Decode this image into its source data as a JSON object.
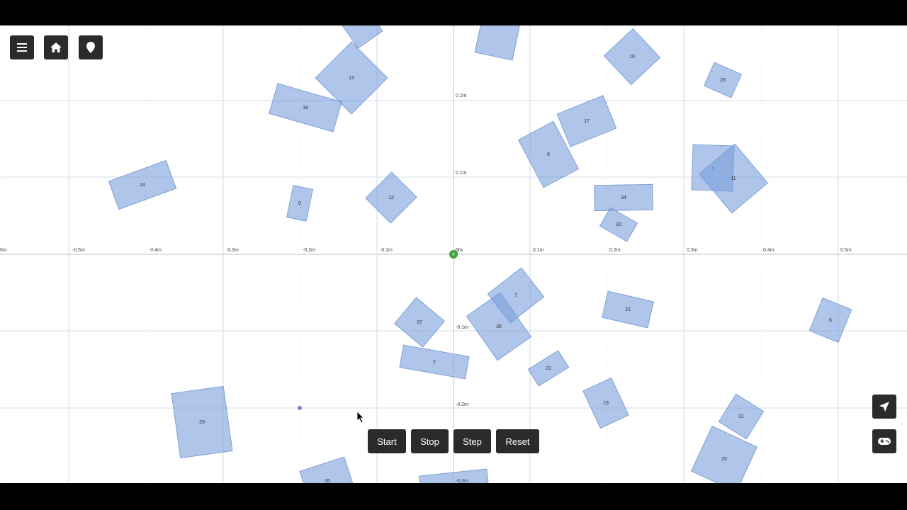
{
  "toolbar": {
    "menu_icon": "menu-icon",
    "home_icon": "home-icon",
    "marker_icon": "map-marker-icon"
  },
  "controls": {
    "start_label": "Start",
    "stop_label": "Stop",
    "step_label": "Step",
    "reset_label": "Reset"
  },
  "side_buttons": {
    "navigate_icon": "navigate-arrow-icon",
    "gamepad_icon": "gamepad-icon"
  },
  "axes": {
    "x_ticks": [
      "6m",
      "-0.5m",
      "-0.4m",
      "-0.3m",
      "-0.2m",
      "-0.1m",
      "0m",
      "0.1m",
      "0.2m",
      "0.3m",
      "0.4m",
      "0.5m"
    ],
    "y_ticks": [
      "0.2m",
      "0.1m",
      "0m",
      "-0.1m",
      "-0.2m",
      "-0.3m"
    ]
  },
  "robot": {
    "label": "0",
    "color": "#3aa33a"
  },
  "target_point": {
    "color": "#8a7fd6"
  },
  "colors": {
    "box_fill": "#7a9fdc",
    "toolbar_bg": "#2b2b2b",
    "grid": "#d6dbe3"
  },
  "boxes": [
    {
      "label": "13"
    },
    {
      "label": "10"
    },
    {
      "label": "26"
    },
    {
      "label": "18"
    },
    {
      "label": "17"
    },
    {
      "label": "8"
    },
    {
      "label": "1"
    },
    {
      "label": "11"
    },
    {
      "label": "14"
    },
    {
      "label": "0"
    },
    {
      "label": "12"
    },
    {
      "label": "34"
    },
    {
      "label": "30"
    },
    {
      "label": "7"
    },
    {
      "label": "36"
    },
    {
      "label": "37"
    },
    {
      "label": "15"
    },
    {
      "label": "6"
    },
    {
      "label": "2"
    },
    {
      "label": "21"
    },
    {
      "label": "19"
    },
    {
      "label": "31"
    },
    {
      "label": "20"
    },
    {
      "label": "25"
    },
    {
      "label": "35"
    },
    {
      "label": ""
    },
    {
      "label": ""
    },
    {
      "label": ""
    }
  ]
}
